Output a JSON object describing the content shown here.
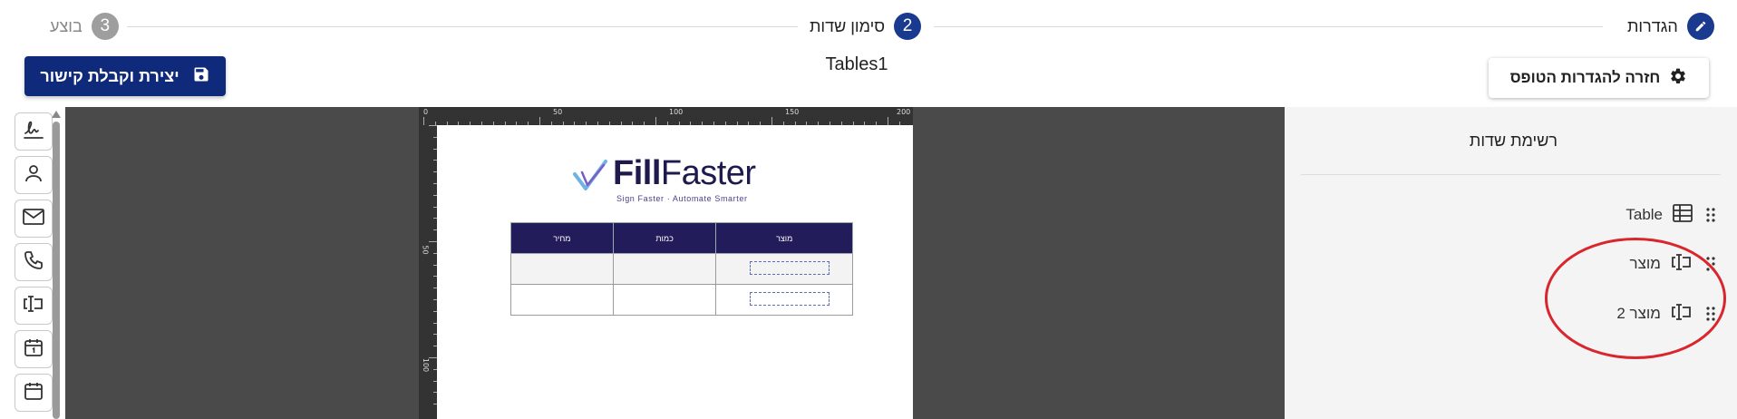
{
  "stepper": {
    "steps": [
      {
        "number": "",
        "label": "הגדרות",
        "state": "done"
      },
      {
        "number": "2",
        "label": "סימון שדות",
        "state": "active"
      },
      {
        "number": "3",
        "label": "בוצע",
        "state": "todo"
      }
    ]
  },
  "header": {
    "save_label": "יצירת וקבלת קישור",
    "document_title": "Tables1",
    "back_label": "חזרה להגדרות הטופס"
  },
  "toolbar": {
    "tools": [
      "signature-icon",
      "person-icon",
      "email-icon",
      "phone-icon",
      "text-field-icon",
      "date-icon",
      "calendar-icon"
    ]
  },
  "canvas": {
    "ruler_top": [
      "0",
      "50",
      "100",
      "150",
      "200"
    ],
    "ruler_left": [
      "50",
      "100"
    ],
    "logo": {
      "bold": "Fill",
      "regular": "Faster",
      "tagline": "Sign Faster · Automate Smarter"
    },
    "table": {
      "headers": [
        "מוצר",
        "כמות",
        "מחיר"
      ]
    }
  },
  "fields_panel": {
    "title": "רשימת שדות",
    "items": [
      {
        "label": "Table",
        "icon": "table-icon"
      },
      {
        "label": "מוצר",
        "icon": "text-field-icon"
      },
      {
        "label": "מוצר 2",
        "icon": "text-field-icon"
      }
    ]
  },
  "colors": {
    "primary": "#0f2a7a",
    "step_active": "#1a3a8f",
    "step_todo": "#9e9e9e",
    "canvas_bg": "#4a4a4a",
    "table_header": "#231c5a",
    "annotation": "#d9262c"
  }
}
